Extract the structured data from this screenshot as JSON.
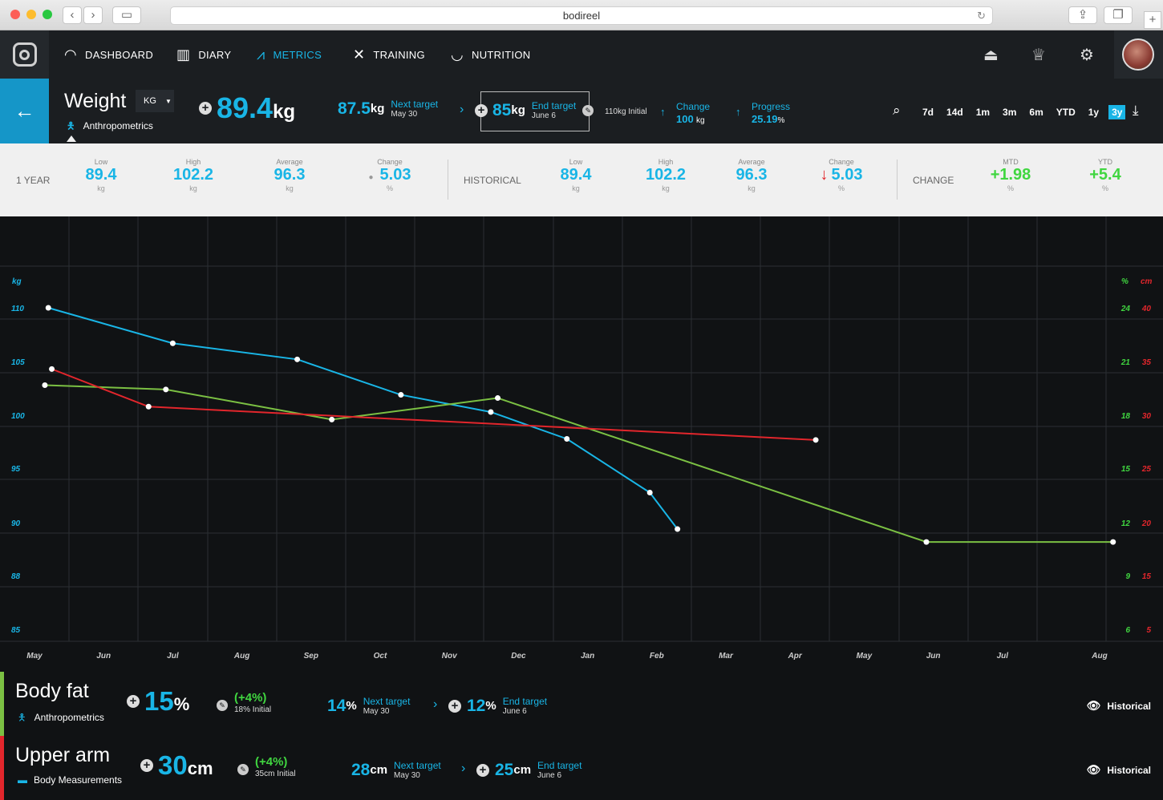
{
  "browser": {
    "url": "bodireel"
  },
  "nav": {
    "items": [
      {
        "label": "DASHBOARD",
        "icon": "gauge-icon"
      },
      {
        "label": "DIARY",
        "icon": "book-icon"
      },
      {
        "label": "METRICS",
        "icon": "trend-icon"
      },
      {
        "label": "TRAINING",
        "icon": "figure-icon"
      },
      {
        "label": "NUTRITION",
        "icon": "bowl-icon"
      }
    ],
    "active": "METRICS"
  },
  "weight": {
    "title": "Weight",
    "unit_select": "KG",
    "category": "Anthropometrics",
    "current": "89.4",
    "current_unit": "kg",
    "next_target_value": "87.5",
    "next_target_unit": "kg",
    "next_target_label": "Next target",
    "next_target_date": "May 30",
    "end_target_value": "85",
    "end_target_unit": "kg",
    "end_target_label": "End target",
    "end_target_date": "June 6",
    "initial": "110kg Initial",
    "change_label": "Change",
    "change_value": "100",
    "change_unit": "kg",
    "progress_label": "Progress",
    "progress_value": "25.19",
    "progress_unit": "%",
    "ranges": [
      "7d",
      "14d",
      "1m",
      "3m",
      "6m",
      "YTD",
      "1y",
      "3y"
    ],
    "selected_range": "3y"
  },
  "stats": {
    "year_label": "1 YEAR",
    "historical_label": "HISTORICAL",
    "change_label": "CHANGE",
    "year": [
      {
        "label": "Low",
        "value": "89.4",
        "unit": "kg"
      },
      {
        "label": "High",
        "value": "102.2",
        "unit": "kg"
      },
      {
        "label": "Average",
        "value": "96.3",
        "unit": "kg"
      },
      {
        "label": "Change",
        "value": "5.03",
        "unit": "%"
      }
    ],
    "historical": [
      {
        "label": "Low",
        "value": "89.4",
        "unit": "kg"
      },
      {
        "label": "High",
        "value": "102.2",
        "unit": "kg"
      },
      {
        "label": "Average",
        "value": "96.3",
        "unit": "kg"
      },
      {
        "label": "Change",
        "value": "5.03",
        "unit": "%"
      }
    ],
    "change": [
      {
        "label": "MTD",
        "value": "+1.98",
        "unit": "%"
      },
      {
        "label": "YTD",
        "value": "+5.4",
        "unit": "%"
      }
    ]
  },
  "colors": {
    "accent": "#19b5e6",
    "green": "#7bc043",
    "red": "#e2262c"
  },
  "chart_data": {
    "type": "line",
    "x": [
      "May",
      "Jun",
      "Jul",
      "Aug",
      "Sep",
      "Oct",
      "Nov",
      "Dec",
      "Jan",
      "Feb",
      "Mar",
      "Apr",
      "May",
      "Jun",
      "Jul",
      "Aug"
    ],
    "y_left_label": "kg",
    "y_left_ticks": [
      "110",
      "105",
      "100",
      "95",
      "90",
      "88",
      "85"
    ],
    "y_right1_label": "%",
    "y_right1_ticks": [
      "24",
      "21",
      "18",
      "15",
      "12",
      "9",
      "6"
    ],
    "y_right2_label": "cm",
    "y_right2_ticks": [
      "40",
      "35",
      "30",
      "25",
      "20",
      "15",
      "5"
    ],
    "grid": true,
    "series": [
      {
        "color": "#19b5e6",
        "points": [
          [
            0.2,
            110
          ],
          [
            2.0,
            106.7
          ],
          [
            3.8,
            105.2
          ],
          [
            5.3,
            101.9
          ],
          [
            6.6,
            100.3
          ],
          [
            7.7,
            97.8
          ],
          [
            8.9,
            92.8
          ],
          [
            9.3,
            89.4
          ]
        ]
      },
      {
        "color": "#7bc043",
        "points": [
          [
            0.15,
            102.8
          ],
          [
            1.9,
            102.4
          ],
          [
            4.3,
            99.6
          ],
          [
            6.7,
            101.6
          ],
          [
            12.9,
            88.2
          ],
          [
            15.6,
            88.2
          ]
        ]
      },
      {
        "color": "#e2262c",
        "points": [
          [
            0.25,
            104.3
          ],
          [
            1.65,
            100.8
          ],
          [
            11.3,
            97.7
          ]
        ]
      }
    ]
  },
  "rows": [
    {
      "title": "Body fat",
      "category": "Anthropometrics",
      "value": "15",
      "unit": "%",
      "change": "(+4%)",
      "initial": "18% Initial",
      "next_value": "14",
      "next_unit": "%",
      "next_label": "Next target",
      "next_date": "May 30",
      "end_value": "12",
      "end_unit": "%",
      "end_label": "End target",
      "end_date": "June 6",
      "historical": "Historical"
    },
    {
      "title": "Upper arm",
      "category": "Body Measurements",
      "value": "30",
      "unit": "cm",
      "change": "(+4%)",
      "initial": "35cm Initial",
      "next_value": "28",
      "next_unit": "cm",
      "next_label": "Next target",
      "next_date": "May 30",
      "end_value": "25",
      "end_unit": "cm",
      "end_label": "End target",
      "end_date": "June 6",
      "historical": "Historical"
    }
  ]
}
